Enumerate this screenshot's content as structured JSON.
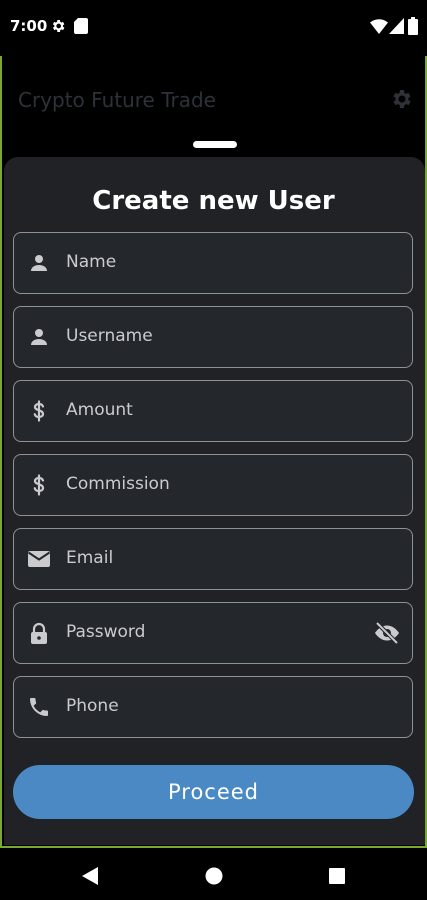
{
  "status_bar": {
    "time": "7:00",
    "left_icons": [
      "gear-icon",
      "sd-card-icon"
    ],
    "right_icons": [
      "wifi-icon",
      "signal-icon",
      "battery-icon"
    ]
  },
  "app_bar": {
    "title": "Crypto Future Trade",
    "settings_icon": "gear-icon"
  },
  "sheet": {
    "title": "Create new User",
    "fields": [
      {
        "label": "Name",
        "icon": "person-icon"
      },
      {
        "label": "Username",
        "icon": "person-icon"
      },
      {
        "label": "Amount",
        "icon": "dollar-icon"
      },
      {
        "label": "Commission",
        "icon": "dollar-icon"
      },
      {
        "label": "Email",
        "icon": "email-icon"
      },
      {
        "label": "Password",
        "icon": "lock-icon",
        "trailing_icon": "visibility-off-icon"
      },
      {
        "label": "Phone",
        "icon": "phone-icon"
      }
    ],
    "proceed_label": "Proceed"
  },
  "nav_bar": {
    "buttons": [
      "back-icon",
      "home-icon",
      "recents-icon"
    ]
  },
  "colors": {
    "accent": "#4a89c4",
    "sheet_bg": "#212225",
    "frame_border": "#79a92e"
  }
}
